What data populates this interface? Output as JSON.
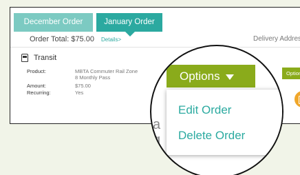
{
  "tabs": [
    {
      "label": "December Order"
    },
    {
      "label": "January Order"
    }
  ],
  "order": {
    "total": "Order Total: $75.00",
    "details_link": "Details>",
    "delivery": "Delivery Address"
  },
  "item": {
    "title": "Transit",
    "rows": [
      {
        "label": "Product:",
        "value_line1": "MBTA Commuter Rail Zone",
        "value_line2": "8 Monthly Pass"
      },
      {
        "label": "Amount:",
        "value_line1": "$75.00"
      },
      {
        "label": "Recurring:",
        "value_line1": "Yes"
      }
    ],
    "small_options": "Options"
  },
  "magnifier": {
    "options_label": "Options",
    "menu": [
      {
        "label": "Edit Order"
      },
      {
        "label": "Delete Order"
      }
    ],
    "behind_1": "a",
    "behind_2": "g"
  },
  "icons": [
    "train-icon",
    "calendar-icon",
    "caret-down-icon"
  ],
  "colors": {
    "background": "#f1f4e8",
    "tab_inactive": "#7ccac2",
    "tab_active": "#2ba9a0",
    "options_button": "#8aab1b",
    "menu_text": "#2baaa0",
    "calendar_icon": "#f0a72b"
  }
}
